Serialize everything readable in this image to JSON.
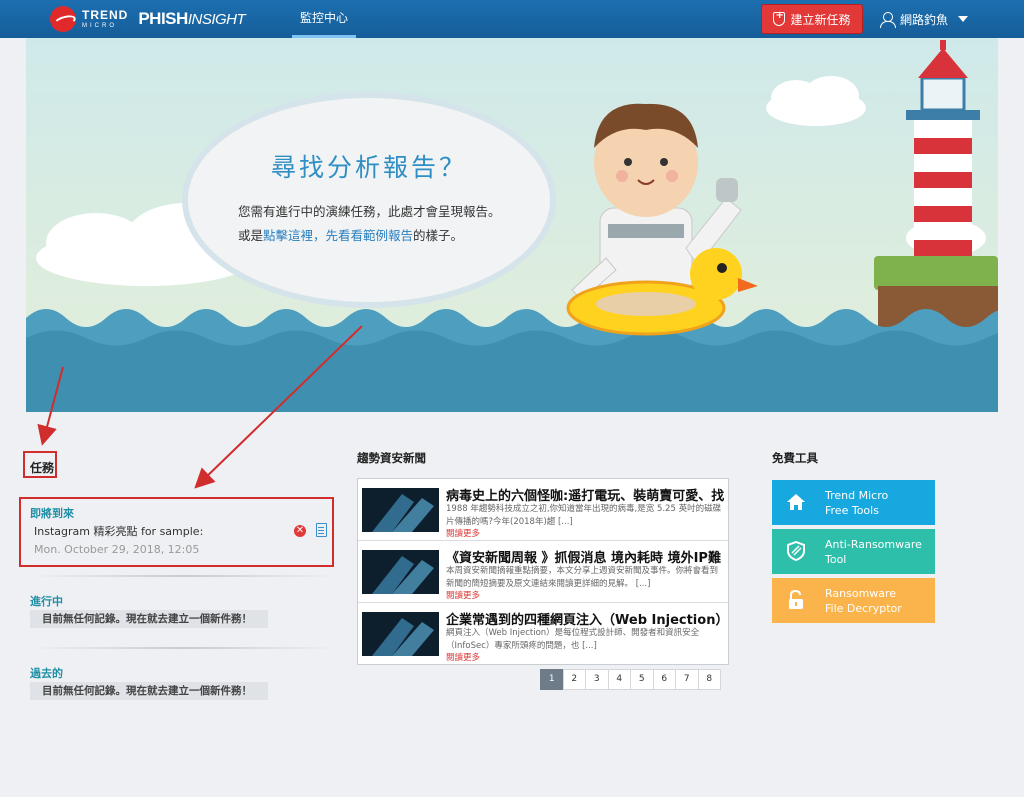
{
  "topbar": {
    "logo_trend": "TREND",
    "logo_micro": "MICRO",
    "logo_phish": "PHISH",
    "logo_insight": "INSIGHT",
    "nav_tab": "監控中心",
    "create_button": "建立新任務",
    "user_name": "網路釣魚"
  },
  "hero": {
    "title": "尋找分析報告？",
    "line1": "您需有進行中的演練任務，此處才會呈現報告。",
    "line2_prefix": "或是",
    "line2_link": "點擊這裡，先看看範例報告",
    "line2_suffix": "的樣子。"
  },
  "tasks": {
    "title": "任務",
    "upcoming_title": "即將到來",
    "upcoming_task_name": "Instagram 精彩亮點 for sample:",
    "upcoming_task_date": "Mon. October 29, 2018, 12:05",
    "delete_glyph": "✕",
    "in_progress_title": "進行中",
    "in_progress_empty": "目前無任何記錄。現在就去建立一個新件務！",
    "past_title": "過去的",
    "past_empty": "目前無任何記錄。現在就去建立一個新件務！"
  },
  "news": {
    "title": "趨勢資安新聞",
    "items": [
      {
        "headline": "病毒史上的六個怪咖:遥打電玩、裝萌賣可愛、找",
        "summary": "1988 年趨勢科技成立之初,你知道當年出現的病毒,是宽 5.25 英吋的磁碟片傳播的嗎?今年(2018年)趨 [...]",
        "more": "閱讀更多"
      },
      {
        "headline": "《資安新聞周報 》抓假消息 境內耗時 境外IP難",
        "summary": "本周資安新聞摘報重點摘要，本文分享上週資安新聞及事件。你將會看到新聞的簡短摘要及原文連結來閱讀更詳細的見解。 [...]",
        "more": "閱讀更多"
      },
      {
        "headline": "企業常遇到的四種網頁注入（Web Injection）攻",
        "summary": "網頁注入（Web Injection）是每位程式設計師、開發者和資訊安全（InfoSec）專家所頭疼的問題，也 [...]",
        "more": "閱讀更多"
      }
    ],
    "pages": [
      "1",
      "2",
      "3",
      "4",
      "5",
      "6",
      "7",
      "8"
    ],
    "active_page": "1"
  },
  "tools": {
    "title": "免費工具",
    "items": [
      {
        "line1": "Trend Micro",
        "line2": "Free Tools",
        "color": "#18a8e0",
        "icon": "home-icon"
      },
      {
        "line1": "Anti-Ransomware",
        "line2": "Tool",
        "color": "#2ebfab",
        "icon": "shield-icon"
      },
      {
        "line1": "Ransomware",
        "line2": "File Decryptor",
        "color": "#fbb34c",
        "icon": "unlock-icon"
      }
    ]
  },
  "colors": {
    "topbar": "#1766a5",
    "create_button": "#e33838",
    "annotation": "#d12d2d",
    "section_title": "#1f8fa6"
  }
}
